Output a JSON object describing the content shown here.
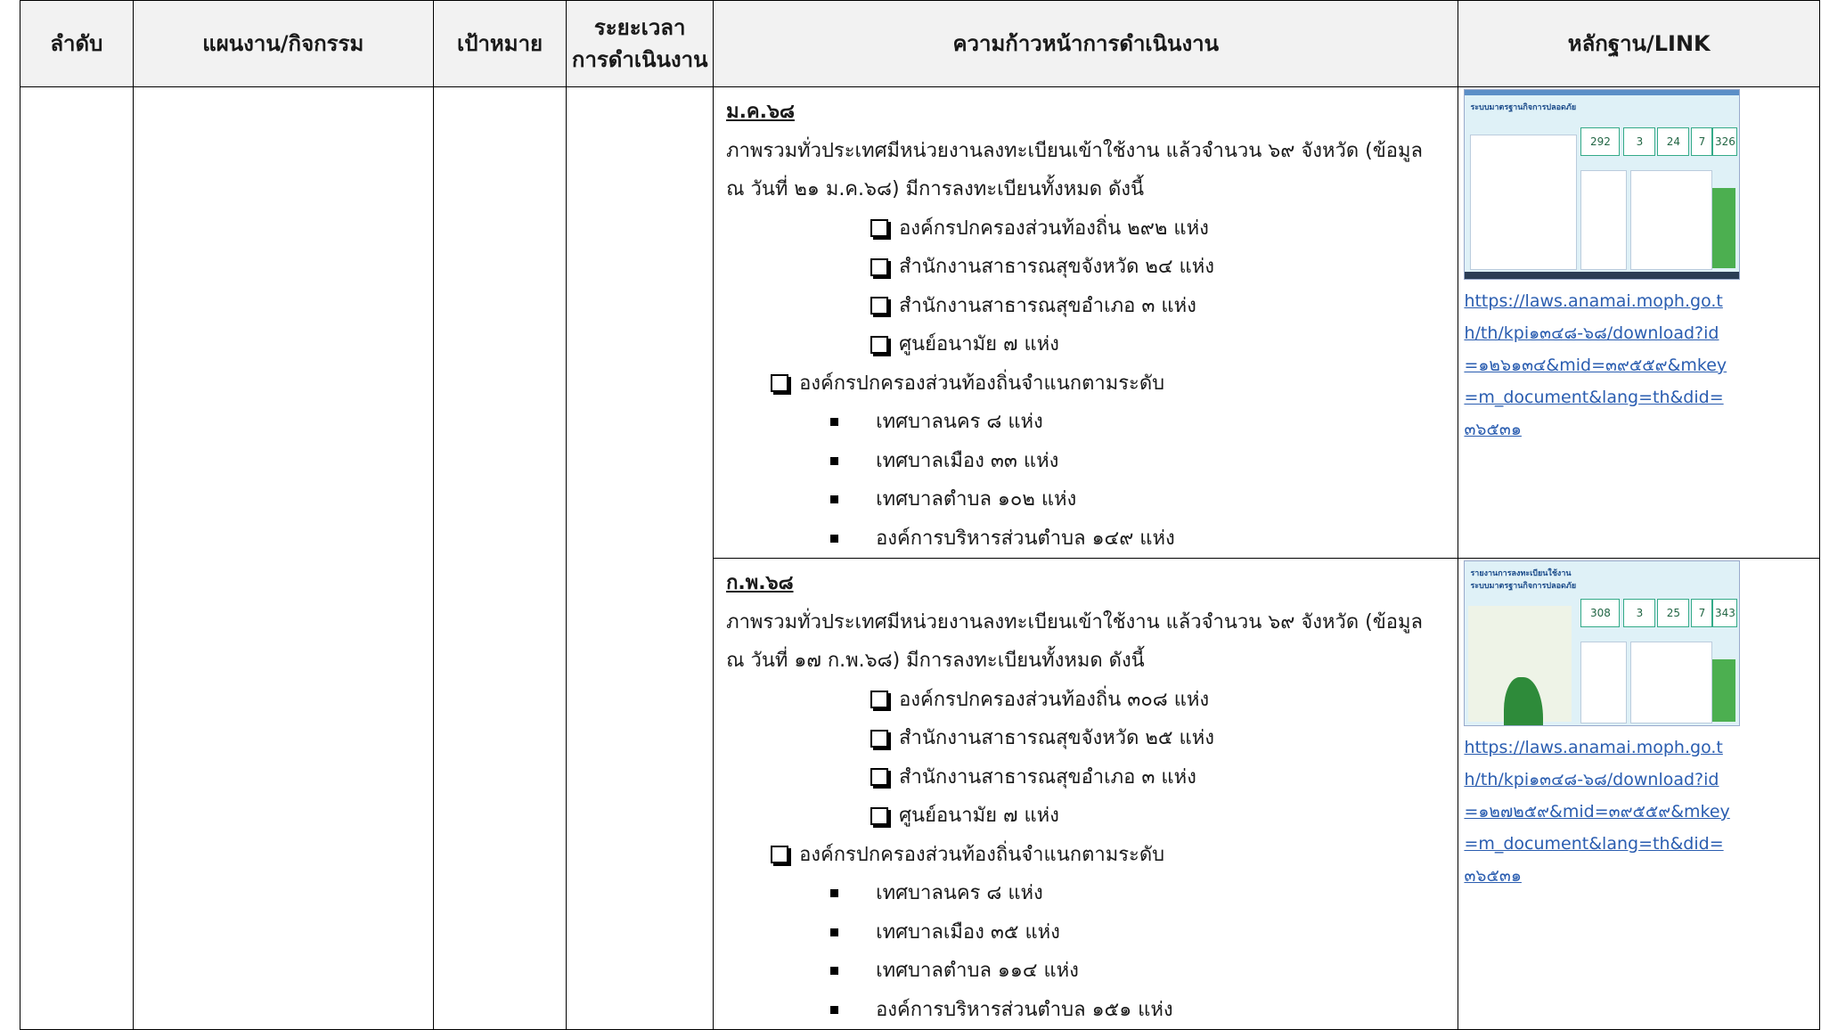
{
  "headers": {
    "no": "ลำดับ",
    "plan": "แผนงาน/กิจกรรม",
    "target": "เป้าหมาย",
    "duration": "ระยะเวลา\nการดำเนินงาน",
    "progress": "ความก้าวหน้าการดำเนินงาน",
    "evidence": "หลักฐาน/LINK"
  },
  "rows": [
    {
      "month": "ม.ค.๖๘",
      "intro1": "ภาพรวมทั่วประเทศมีหน่วยงานลงทะเบียนเข้าใช้งาน แล้วจำนวน ๖๙ จังหวัด (ข้อมูล",
      "intro2": "ณ วันที่ ๒๑ ม.ค.๖๘) มีการลงทะเบียนทั้งหมด  ดังนี้",
      "checklist": [
        "องค์กรปกครองส่วนท้องถิ่น ๒๙๒ แห่ง",
        "สำนักงานสาธารณสุขจังหวัด ๒๔ แห่ง",
        "สำนักงานสาธารณสุขอำเภอ ๓ แห่ง",
        "ศูนย์อนามัย  ๗ แห่ง"
      ],
      "local_heading": "องค์กรปกครองส่วนท้องถิ่นจำแนกตามระดับ",
      "levels": [
        "เทศบาลนคร ๘ แห่ง",
        "เทศบาลเมือง ๓๓ แห่ง",
        "เทศบาลตำบล ๑๐๒ แห่ง",
        "องค์การบริหารส่วนตำบล ๑๔๙ แห่ง"
      ],
      "link": "https://laws.anamai.moph.go.th/th/kpi๑๓๔๘-๖๘/download?id=๑๒๖๑๓๔&mid=๓๙๕๕๙&mkey=m_document&lang=th&did=๓๖๕๓๑",
      "shot": {
        "title": "ระบบมาตรฐานกิจการปลอดภัย",
        "kpis": [
          "292",
          "3",
          "24",
          "7",
          "326"
        ]
      }
    },
    {
      "month": "ก.พ.๖๘",
      "intro1": "ภาพรวมทั่วประเทศมีหน่วยงานลงทะเบียนเข้าใช้งาน แล้วจำนวน ๖๙ จังหวัด (ข้อมูล",
      "intro2": "ณ วันที่ ๑๗ ก.พ.๖๘) มีการลงทะเบียนทั้งหมด  ดังนี้",
      "checklist": [
        "องค์กรปกครองส่วนท้องถิ่น ๓๐๘ แห่ง",
        "สำนักงานสาธารณสุขจังหวัด ๒๕ แห่ง",
        "สำนักงานสาธารณสุขอำเภอ ๓ แห่ง",
        "ศูนย์อนามัย  ๗ แห่ง"
      ],
      "local_heading": "องค์กรปกครองส่วนท้องถิ่นจำแนกตามระดับ",
      "levels": [
        "เทศบาลนคร ๘ แห่ง",
        "เทศบาลเมือง ๓๕ แห่ง",
        "เทศบาลตำบล ๑๑๔ แห่ง",
        "องค์การบริหารส่วนตำบล ๑๕๑ แห่ง"
      ],
      "link": "https://laws.anamai.moph.go.th/th/kpi๑๓๔๘-๖๘/download?id=๑๒๗๒๕๙&mid=๓๙๕๕๙&mkey=m_document&lang=th&did=๓๖๕๓๑",
      "shot": {
        "title": "รายงานการลงทะเบียนใช้งาน\nระบบมาตรฐานกิจการปลอดภัย",
        "kpis": [
          "308",
          "3",
          "25",
          "7",
          "343"
        ]
      }
    }
  ]
}
